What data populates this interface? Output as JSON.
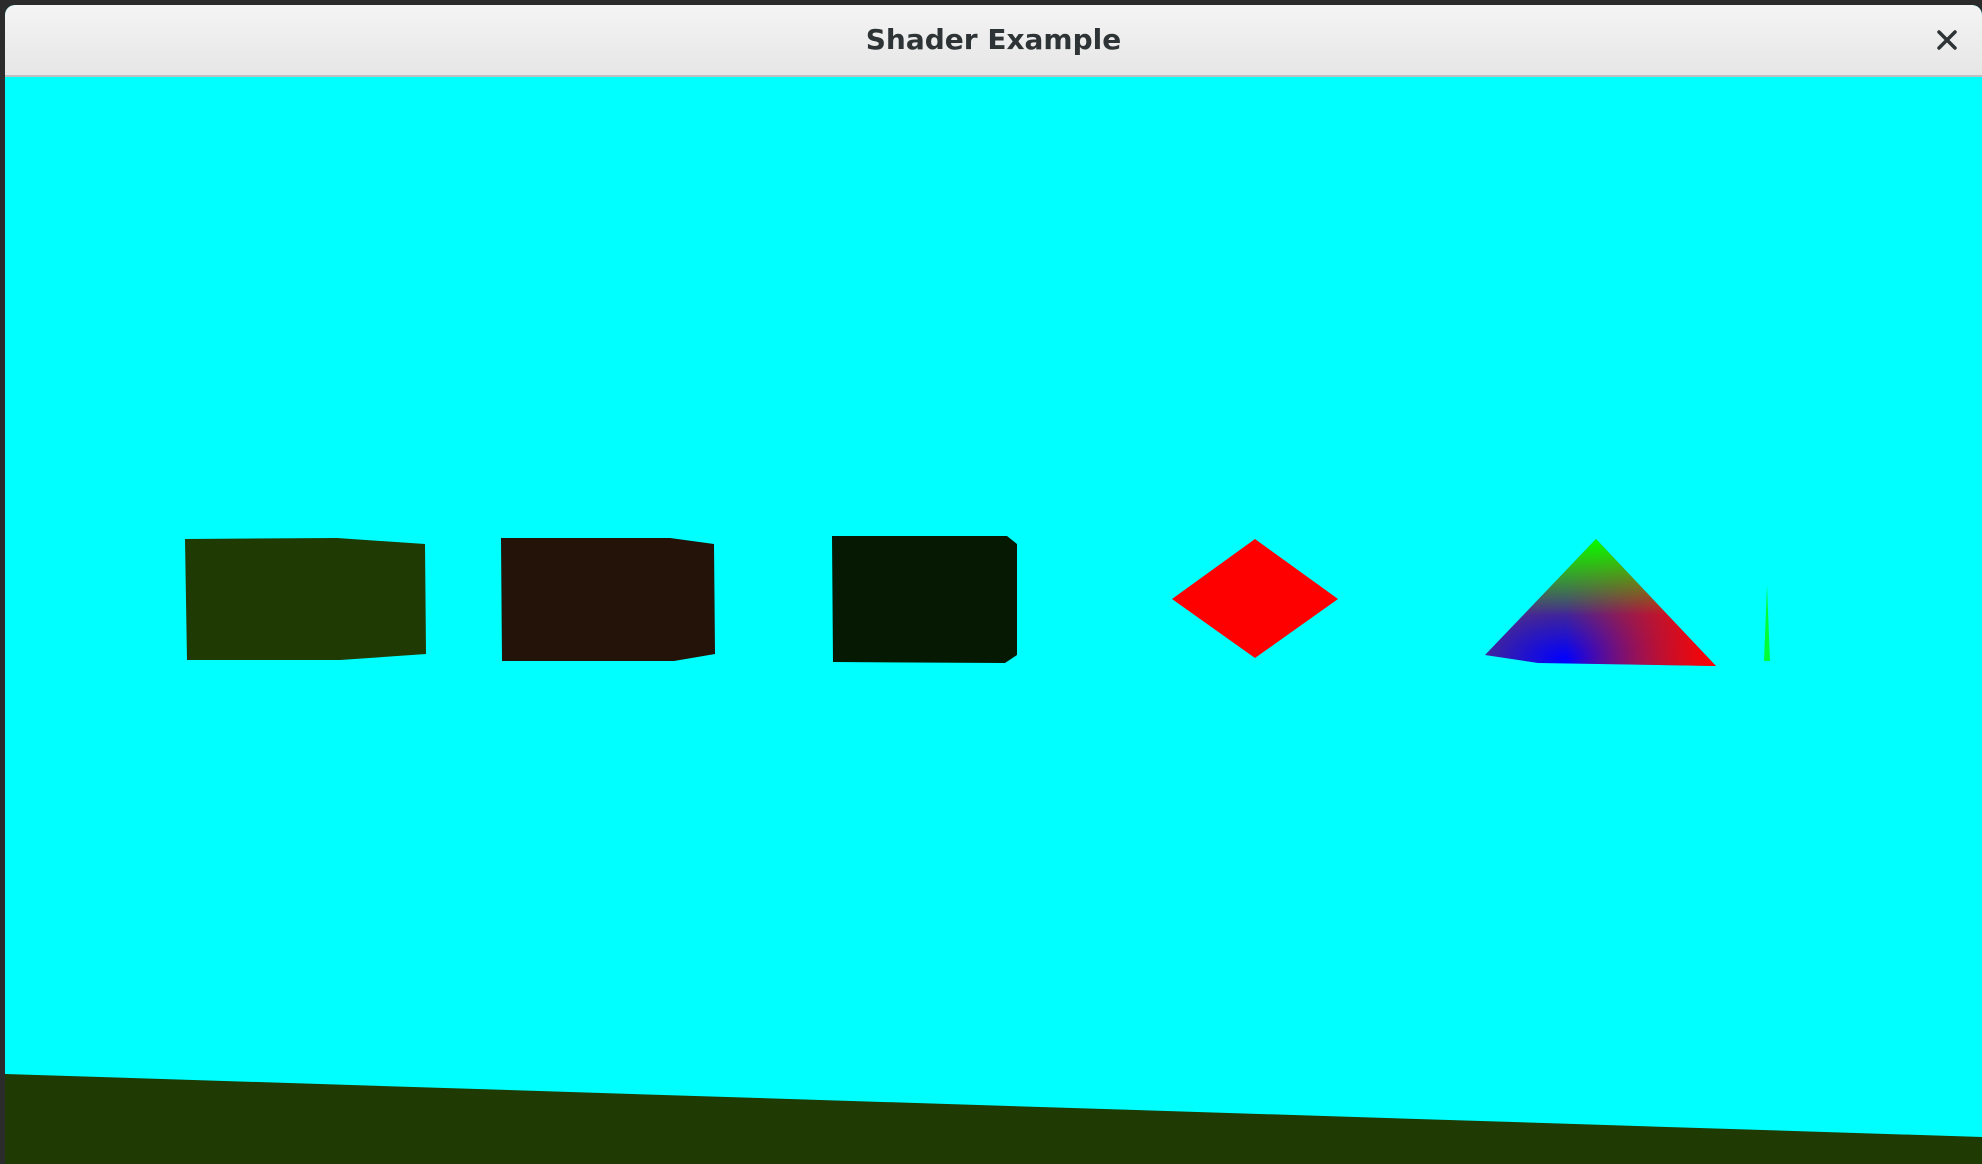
{
  "window": {
    "title": "Shader Example"
  },
  "titlebar": {
    "close_icon": "close-icon"
  },
  "scene": {
    "background_color": "#00ffff",
    "ground_color": "#1f3a02",
    "objects": [
      {
        "name": "cube-olive",
        "color": "#1f3a02"
      },
      {
        "name": "cube-brown",
        "color": "#231308"
      },
      {
        "name": "cube-dark-green",
        "color": "#061a03"
      },
      {
        "name": "diamond-red",
        "color": "#ff0000"
      },
      {
        "name": "pyramid-rgb",
        "colors": [
          "#00ff00",
          "#0000ff",
          "#ff0000"
        ]
      },
      {
        "name": "sliver-green",
        "color": "#00ff33"
      }
    ]
  }
}
